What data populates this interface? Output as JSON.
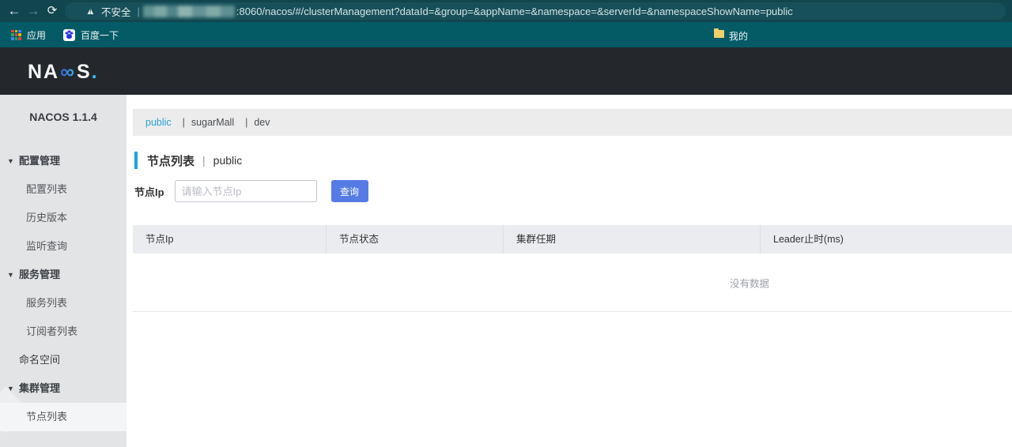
{
  "browser": {
    "toolbar": {
      "security_label": "不安全",
      "url_separator": "|",
      "url_visible": ":8060/nacos/#/clusterManagement?dataId=&group=&appName=&namespace=&serverId=&namespaceShowName=public"
    },
    "bookmarks_bar": {
      "apps_label": "应用",
      "baidu_label": "百度一下",
      "my_folder_label": "我的"
    }
  },
  "app_header": {
    "logo": {
      "na": "NA",
      "co_glyph": "∞",
      "s": "S",
      "dot": "."
    }
  },
  "sidebar": {
    "version": "NACOS 1.1.4",
    "caret_glyph": "▼",
    "items": [
      {
        "label": "配置管理",
        "type": "group",
        "expanded": true
      },
      {
        "label": "配置列表",
        "type": "sub"
      },
      {
        "label": "历史版本",
        "type": "sub"
      },
      {
        "label": "监听查询",
        "type": "sub"
      },
      {
        "label": "服务管理",
        "type": "group",
        "expanded": true
      },
      {
        "label": "服务列表",
        "type": "sub"
      },
      {
        "label": "订阅者列表",
        "type": "sub"
      },
      {
        "label": "命名空间",
        "type": "top"
      },
      {
        "label": "集群管理",
        "type": "group",
        "expanded": true
      },
      {
        "label": "节点列表",
        "type": "sub",
        "selected": true
      }
    ]
  },
  "namespace_tabs": {
    "separator": "|",
    "tabs": [
      {
        "label": "public",
        "active": true
      },
      {
        "label": "sugarMall",
        "active": false
      },
      {
        "label": "dev",
        "active": false
      }
    ]
  },
  "page": {
    "title": "节点列表",
    "title_separator": "|",
    "title_namespace": "public",
    "query": {
      "label": "节点Ip",
      "placeholder": "请输入节点Ip",
      "button_label": "查询"
    },
    "table": {
      "columns": [
        "节点Ip",
        "节点状态",
        "集群任期",
        "Leader止时(ms)"
      ],
      "rows": [],
      "empty_text": "没有数据"
    }
  },
  "colors": {
    "toolbar_teal": "#11464f",
    "bookmarks_teal": "#045b66",
    "header_dark": "#24282d",
    "sidebar_gray": "#e3e4e6",
    "namespace_bar_gray": "#ececec",
    "table_header_gray": "#eaecef",
    "accent_button_blue": "#567be4",
    "link_cyan": "#2aa0d6",
    "title_accent_cyan": "#1ba2e0"
  }
}
